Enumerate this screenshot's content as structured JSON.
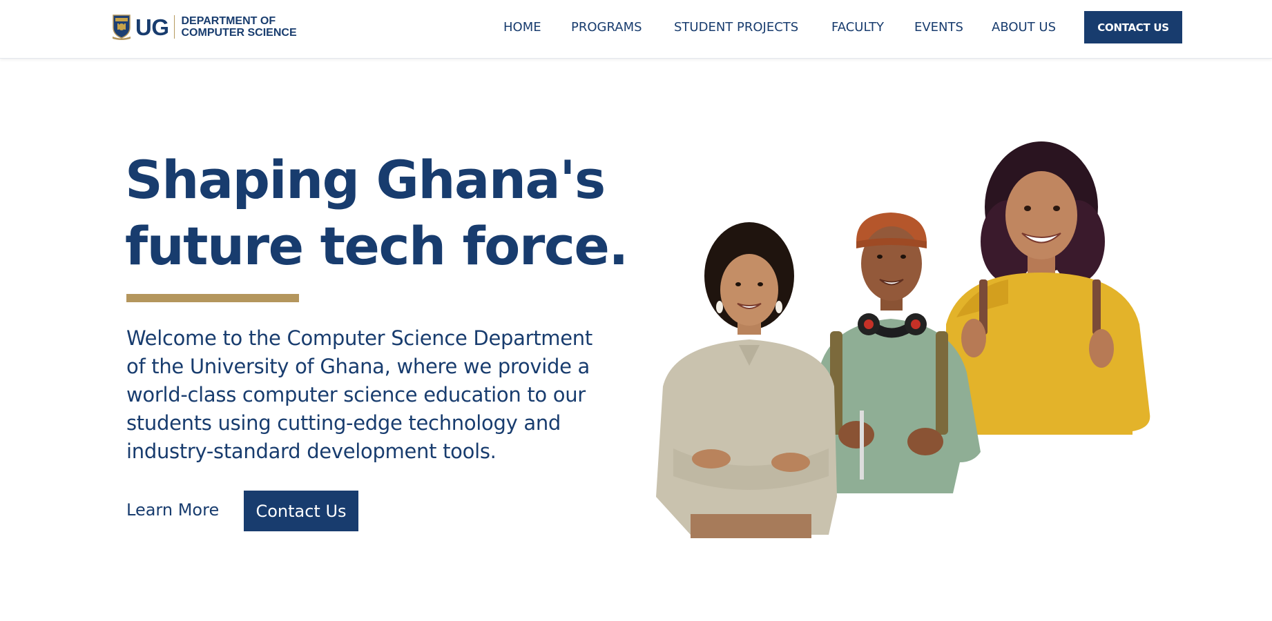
{
  "brand": {
    "logo_mark": "university-crest-icon",
    "abbr": "UG",
    "dept_line1": "DEPARTMENT OF",
    "dept_line2": "COMPUTER SCIENCE"
  },
  "nav": {
    "items": [
      {
        "label": "HOME"
      },
      {
        "label": "PROGRAMS"
      },
      {
        "label": "STUDENT PROJECTS"
      },
      {
        "label": "FACULTY"
      },
      {
        "label": "EVENTS"
      },
      {
        "label": "ABOUT US"
      }
    ],
    "cta_label": "CONTACT US"
  },
  "hero": {
    "title_line1": "Shaping Ghana's",
    "title_line2": "future tech force.",
    "description_lines": [
      "Welcome to the Computer Science Department",
      "of the University of Ghana, where we provide a",
      "world-class computer science education to our",
      "students using cutting-edge technology and",
      "industry-standard development tools."
    ],
    "learn_more_label": "Learn More",
    "cta_label": "Contact Us",
    "image": "three-smiling-students-photo"
  },
  "colors": {
    "primary": "#183c6e",
    "accent_gold": "#b4965d",
    "background": "#ffffff"
  }
}
